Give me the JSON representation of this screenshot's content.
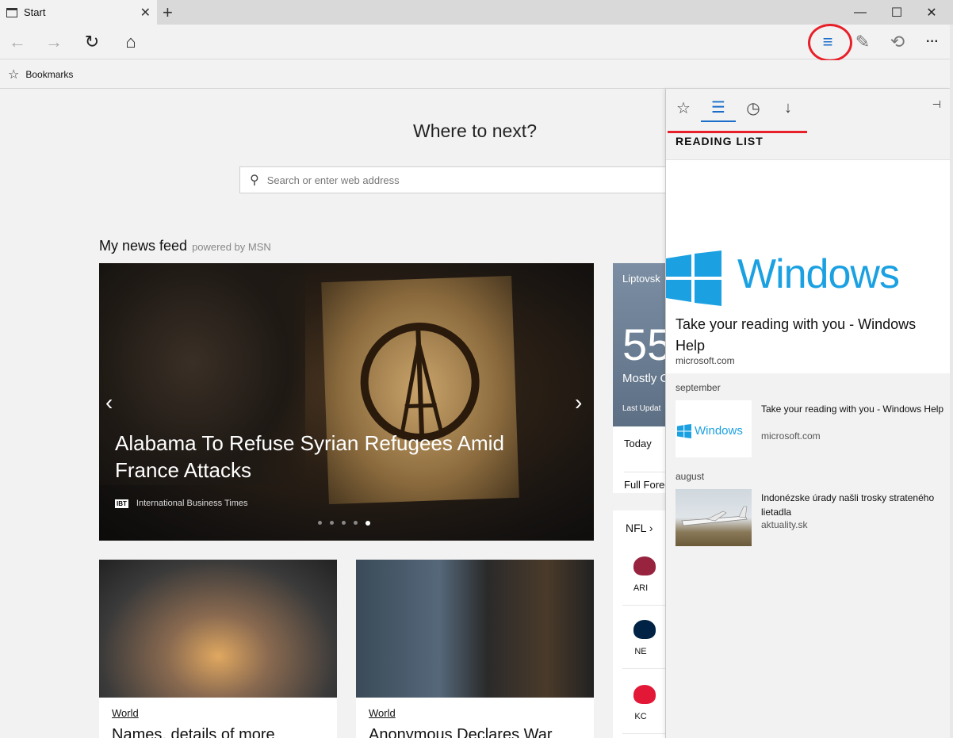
{
  "window": {
    "tab_title": "Start",
    "tab_icon": "page-icon",
    "new_tab_label": "+",
    "controls": {
      "minimize": "—",
      "maximize": "☐",
      "close": "✕"
    }
  },
  "nav": {
    "back": "←",
    "forward": "→",
    "refresh": "↻",
    "home": "⌂",
    "hub": "≡",
    "note": "✎",
    "share": "⟲",
    "more": "···"
  },
  "favorites_bar": {
    "items": [
      {
        "label": "Bookmarks",
        "icon": "star-icon"
      }
    ]
  },
  "start": {
    "heading": "Where to next?",
    "search_placeholder": "Search or enter web address",
    "news_feed_title": "My news feed",
    "powered_by": "powered by MSN",
    "hero": {
      "headline": "Alabama To Refuse Syrian Refugees Amid France Attacks",
      "source": "International Business Times",
      "source_logo": "IBT",
      "slide_count": 5,
      "active_slide": 5
    },
    "cards": [
      {
        "category": "World",
        "title": "Names, details of more"
      },
      {
        "category": "World",
        "title": "Anonymous Declares War"
      }
    ],
    "weather": {
      "city": "Liptovsk",
      "temp": "55",
      "condition": "Mostly C",
      "updated": "Last Updat",
      "links": [
        "Today",
        "Full Forec"
      ]
    },
    "nfl": {
      "header": "NFL ›",
      "teams": [
        {
          "abbr": "ARI",
          "color": "#97233f"
        },
        {
          "abbr": "NE",
          "color": "#002244"
        },
        {
          "abbr": "KC",
          "color": "#e31837"
        }
      ]
    }
  },
  "hub": {
    "tabs": [
      "☆",
      "☰",
      "◷",
      "↓"
    ],
    "active_tab": 1,
    "pin": "⊣",
    "title": "READING LIST",
    "featured": {
      "logo_text": "Windows",
      "title": "Take your reading with you - Windows Help",
      "source": "microsoft.com"
    },
    "groups": [
      {
        "label": "september",
        "items": [
          {
            "title": "Take your reading with you - Windows Help",
            "source": "microsoft.com",
            "thumb_text": "Windows"
          }
        ]
      },
      {
        "label": "august",
        "items": [
          {
            "title": "Indonézske úrady našli trosky strateného lietadla",
            "source": "aktuality.sk"
          }
        ]
      }
    ]
  }
}
